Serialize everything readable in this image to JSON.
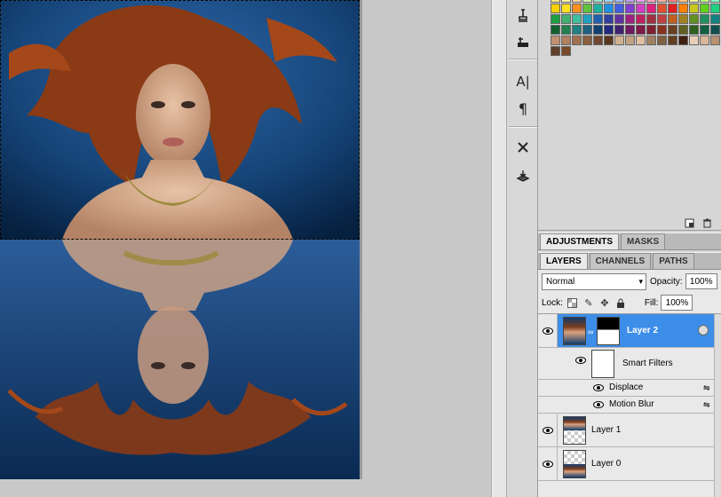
{
  "panels": {
    "adjustments_tab": "ADJUSTMENTS",
    "masks_tab": "MASKS",
    "layers_tab": "LAYERS",
    "channels_tab": "CHANNELS",
    "paths_tab": "PATHS"
  },
  "layers_panel": {
    "blend_mode": "Normal",
    "opacity_label": "Opacity:",
    "opacity_value": "100%",
    "lock_label": "Lock:",
    "fill_label": "Fill:",
    "fill_value": "100%",
    "layers": [
      {
        "name": "Layer 2",
        "selected": true
      },
      {
        "name": "Smart Filters"
      },
      {
        "name": "Displace"
      },
      {
        "name": "Motion Blur"
      },
      {
        "name": "Layer 1"
      },
      {
        "name": "Layer 0"
      }
    ]
  },
  "tools": [
    "clone-source-icon",
    "tool-presets-icon",
    "character-icon",
    "paragraph-icon",
    "tools-icon",
    "3d-icon"
  ],
  "colors": {
    "selection_highlight": "#3d8ee8",
    "canvas_background": "#0b2c58"
  },
  "swatches": [
    "#ffe680",
    "#fff4a0",
    "#ffd0a0",
    "#d0f0b0",
    "#a0e0d0",
    "#a0d8ff",
    "#a0b8ff",
    "#c0a0ff",
    "#f0a0ff",
    "#ffa0c0",
    "#ffb0a0",
    "#ff8080",
    "#ffc080",
    "#f0f0a0",
    "#c0ff80",
    "#80ffc0",
    "#80c0ff",
    "#ffd000",
    "#ffe020",
    "#ff9020",
    "#60c040",
    "#20b0a0",
    "#2090e0",
    "#4060e0",
    "#8040d0",
    "#d040c0",
    "#e02080",
    "#e05030",
    "#e02020",
    "#ff8000",
    "#c8c820",
    "#60d020",
    "#20d080",
    "#2080d0",
    "#20a040",
    "#40b070",
    "#40c0a0",
    "#20a0c0",
    "#2060b0",
    "#3040a0",
    "#6030a0",
    "#a02080",
    "#c02060",
    "#a03040",
    "#c04040",
    "#c06020",
    "#a08020",
    "#609020",
    "#209060",
    "#108080",
    "#205090",
    "#106030",
    "#208050",
    "#208080",
    "#206080",
    "#104070",
    "#202880",
    "#402070",
    "#701860",
    "#801848",
    "#802030",
    "#8a3020",
    "#6a4020",
    "#606020",
    "#306020",
    "#106040",
    "#105050",
    "#103060",
    "#c09070",
    "#b08060",
    "#a07050",
    "#8a6040",
    "#704830",
    "#5a3820",
    "#d0b090",
    "#c0a080",
    "#e0c0a0",
    "#a08060",
    "#806040",
    "#604020",
    "#402010",
    "#e8d0b8",
    "#d8b898",
    "#b89070",
    "#906848",
    "#604028",
    "#7a4a28"
  ]
}
